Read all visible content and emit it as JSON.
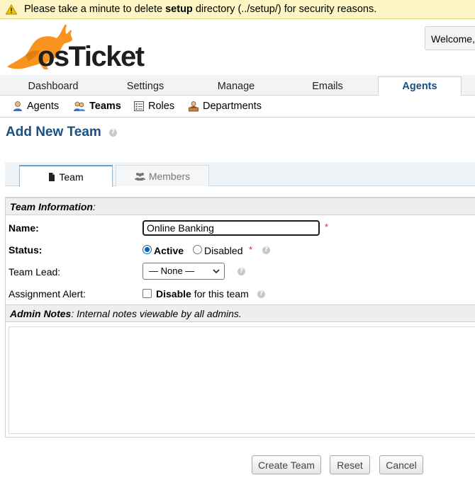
{
  "warning": {
    "prefix": "Please take a minute to delete",
    "bold": "setup",
    "suffix": "directory (../setup/) for security reasons."
  },
  "header": {
    "logo_text": "osTicket",
    "welcome": "Welcome,"
  },
  "nav": {
    "tabs": [
      {
        "label": "Dashboard"
      },
      {
        "label": "Settings"
      },
      {
        "label": "Manage"
      },
      {
        "label": "Emails"
      },
      {
        "label": "Agents"
      }
    ],
    "active": "Agents"
  },
  "subnav": {
    "items": [
      {
        "label": "Agents",
        "icon": "agent-icon"
      },
      {
        "label": "Teams",
        "icon": "teams-icon"
      },
      {
        "label": "Roles",
        "icon": "roles-icon"
      },
      {
        "label": "Departments",
        "icon": "departments-icon"
      }
    ],
    "active": "Teams"
  },
  "page": {
    "title": "Add New Team",
    "help": "?"
  },
  "form_tabs": [
    {
      "label": "Team",
      "icon": "document-icon"
    },
    {
      "label": "Members",
      "icon": "users-icon"
    }
  ],
  "form": {
    "team_info_title": "Team Information",
    "team_info_colon": ":",
    "name_label": "Name:",
    "name_value": "Online Banking",
    "required_mark": "*",
    "status_label": "Status:",
    "status_active": "Active",
    "status_disabled": "Disabled",
    "status_selected": "Active",
    "team_lead_label": "Team Lead:",
    "team_lead_value": "— None —",
    "alert_label": "Assignment Alert:",
    "alert_disable": "Disable",
    "alert_suffix": "for this team",
    "alert_checked": false,
    "notes_title": "Admin Notes",
    "notes_desc": ": Internal notes viewable by all admins.",
    "notes_value": ""
  },
  "buttons": {
    "create": "Create Team",
    "reset": "Reset",
    "cancel": "Cancel"
  },
  "colors": {
    "accent": "#184e81",
    "warning_bg": "#fdf6c4",
    "required": "#dd2222",
    "logo_orange": "#f7931e"
  }
}
